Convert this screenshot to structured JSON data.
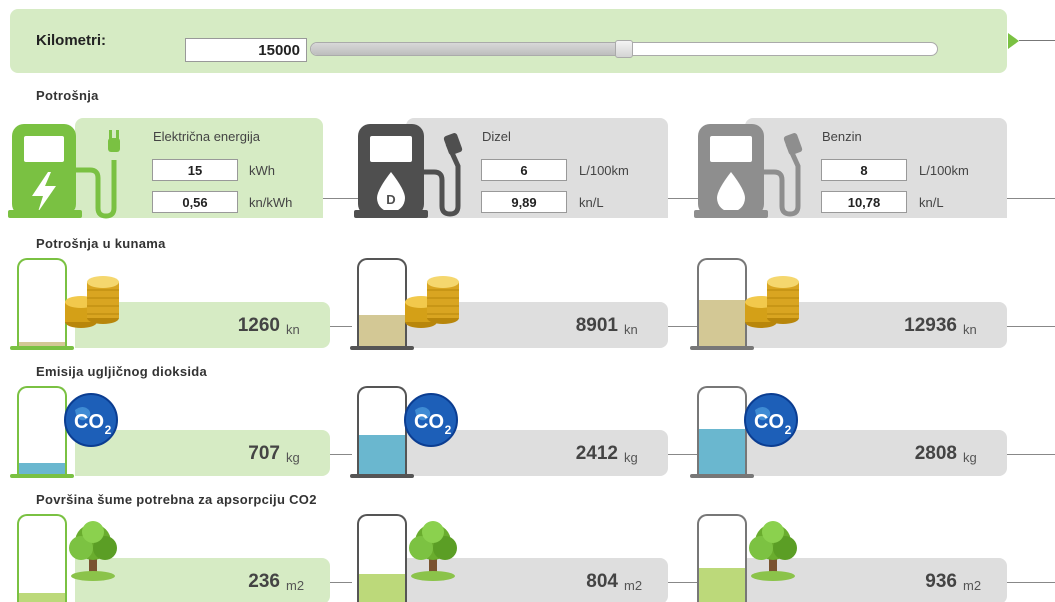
{
  "slider": {
    "label": "Kilometri:",
    "value": "15000",
    "position_fraction": 0.5
  },
  "sections": {
    "consumption": "Potrošnja",
    "cost": "Potrošnja u kunama",
    "co2": "Emisija ugljičnog dioksida",
    "forest": "Površina šume potrebna za apsorpciju CO2"
  },
  "fuels": [
    {
      "name": "Električna energija",
      "consumption": "15",
      "consumption_unit": "kWh",
      "price": "0,56",
      "price_unit": "kn/kWh",
      "pump_icon": "ev-charger-icon"
    },
    {
      "name": "Dizel",
      "consumption": "6",
      "consumption_unit": "L/100km",
      "price": "9,89",
      "price_unit": "kn/L",
      "pump_icon": "diesel-pump-icon"
    },
    {
      "name": "Benzin",
      "consumption": "8",
      "consumption_unit": "L/100km",
      "price": "10,78",
      "price_unit": "kn/L",
      "pump_icon": "petrol-pump-icon"
    }
  ],
  "results": {
    "cost": [
      {
        "value": "1260",
        "unit": "kn",
        "fill_fraction": 0.05
      },
      {
        "value": "8901",
        "unit": "kn",
        "fill_fraction": 0.36
      },
      {
        "value": "12936",
        "unit": "kn",
        "fill_fraction": 0.53
      }
    ],
    "co2": [
      {
        "value": "707",
        "unit": "kg",
        "fill_fraction": 0.13
      },
      {
        "value": "2412",
        "unit": "kg",
        "fill_fraction": 0.45
      },
      {
        "value": "2808",
        "unit": "kg",
        "fill_fraction": 0.52
      }
    ],
    "forest": [
      {
        "value": "236",
        "unit": "m2",
        "fill_fraction": 0.1
      },
      {
        "value": "804",
        "unit": "m2",
        "fill_fraction": 0.33
      },
      {
        "value": "936",
        "unit": "m2",
        "fill_fraction": 0.4
      }
    ]
  },
  "icons": {
    "cost": "coins-icon",
    "co2": "co2-globe-icon",
    "forest": "tree-icon",
    "co2_text": "CO",
    "co2_sub": "2",
    "diesel_letter": "D"
  },
  "colors": {
    "electric_bg": "#d6ebc4",
    "fuel_bg": "#dedede",
    "electric_accent": "#7ac142",
    "diesel_dark": "#4f4f4f",
    "petrol_gray": "#8e8e8e",
    "cost_fill": "#d3c895",
    "co2_fill": "#6ab7cf",
    "forest_fill": "#bcd97a"
  }
}
